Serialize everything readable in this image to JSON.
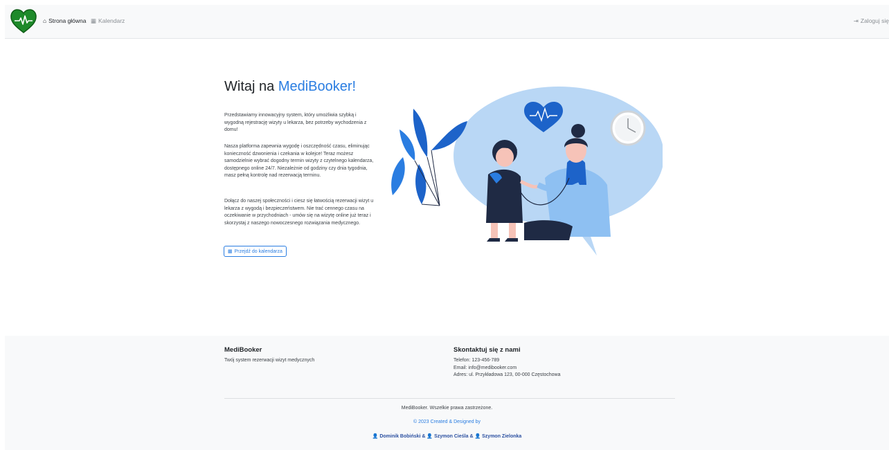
{
  "nav": {
    "home_label": "Strona główna",
    "calendar_label": "Kalendarz",
    "login_label": "Zaloguj się",
    "home_icon": "⌂",
    "calendar_icon": "▦",
    "login_icon": "⇥"
  },
  "hero": {
    "title_prefix": "Witaj na ",
    "title_brand": "MediBooker!",
    "paragraphs": [
      "Przedstawiamy innowacyjny system, który umożliwia szybką i wygodną rejestrację wizyty u lekarza, bez potrzeby wychodzenia z domu!",
      "Nasza platforma zapewnia wygodę i oszczędność czasu, eliminując konieczność dzwonienia i czekania w kolejce! Teraz możesz samodzielnie wybrać dogodny termin wizyty z czytelnego kalendarza, dostępnego online 24/7. Niezależnie od godziny czy dnia tygodnia, masz pełną kontrolę nad rezerwacją terminu.",
      "Dołącz do naszej społeczności i ciesz się łatwością rezerwacji wizyt u lekarza z wygodą i bezpieczeństwem. Nie trać cennego czasu na oczekiwanie w przychodniach - umów się na wizytę online już teraz i skorzystaj z naszego nowoczesnego rozwiązania medycznego."
    ],
    "button_label": "Przejdź do kalendarza",
    "button_icon": "▦"
  },
  "footer": {
    "brand": "MediBooker",
    "tagline": "Twój system rezerwacji wizyt medycznych",
    "contact_title": "Skontaktuj się z nami",
    "phone": "Telefon: 123-456-789",
    "email": "Email: info@medibooker.com",
    "address": "Adres: ul. Przykładowa 123, 00-000 Częstochowa",
    "rights": "MediBooker. Wszelkie prawa zastrzeżone.",
    "credit": "© 2023 Created & Designed by",
    "authors": [
      "Dominik Bobiński",
      "Szymon Cieśla",
      "Szymon Zielonka"
    ],
    "author_separator": " & ",
    "author_icon": "👤"
  },
  "colors": {
    "brand": "#2a7de1",
    "logo_green": "#1e8a2a",
    "illustration_blob": "#b9d7f5",
    "illustration_dark": "#1f2a44"
  }
}
